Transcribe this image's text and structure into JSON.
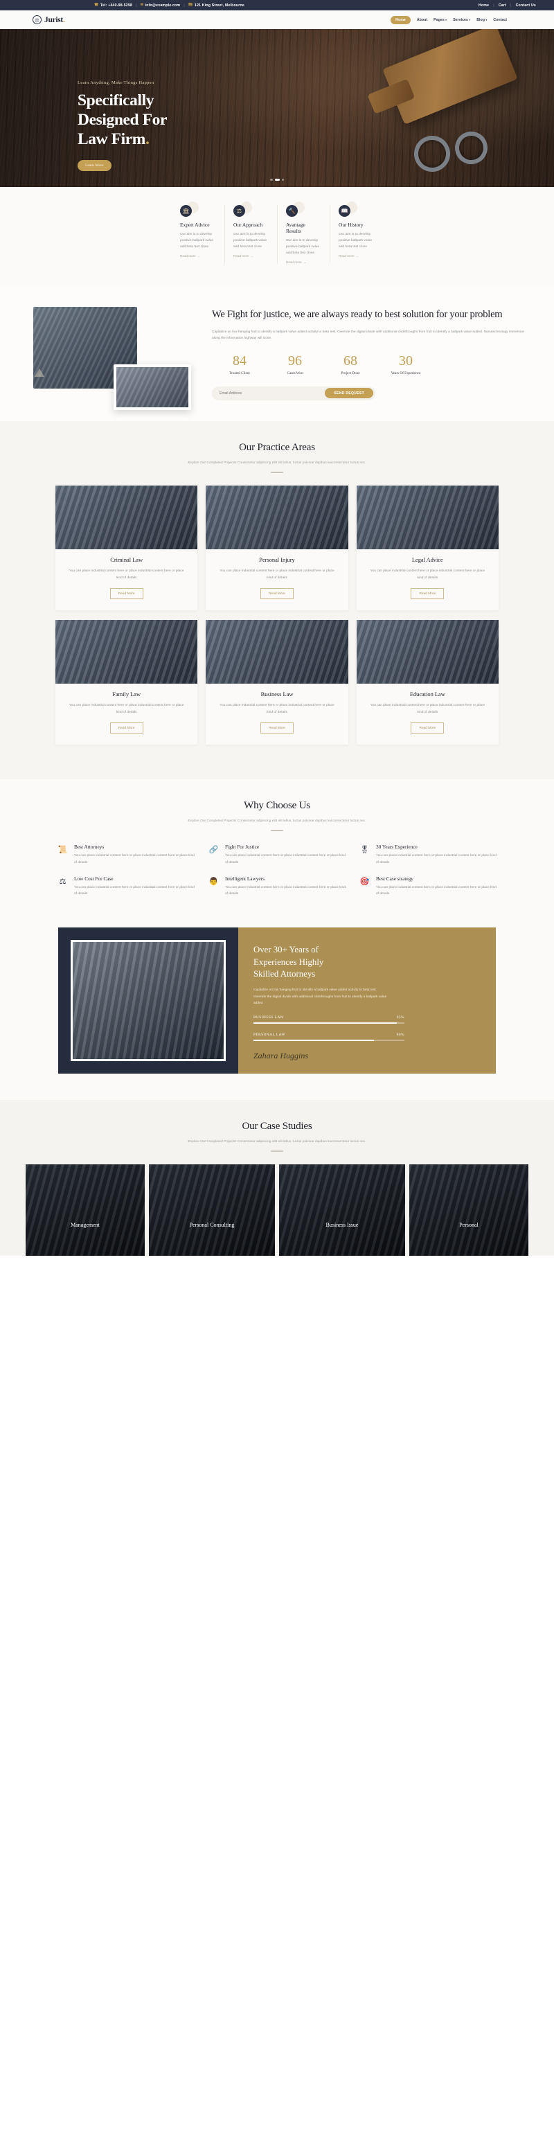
{
  "topbar": {
    "phone": "Tel: +440-98-5298",
    "email": "info@example.com",
    "address": "121 King Street, Melbourne",
    "phone_icon": "phone-icon",
    "email_icon": "envelope-icon",
    "address_icon": "map-icon",
    "links": [
      "Home",
      "Cart",
      "Contact Us"
    ],
    "sep": "|",
    "bg": "#2b3245",
    "accent": "#c9a24a"
  },
  "nav": {
    "brand": "Jurist",
    "brand_dot": ".",
    "brand_icon": "scales-shield-icon",
    "items": [
      {
        "label": "Home",
        "caret": "",
        "active": true
      },
      {
        "label": "About",
        "caret": "",
        "active": false
      },
      {
        "label": "Pages",
        "caret": "▾",
        "active": false
      },
      {
        "label": "Services",
        "caret": "▾",
        "active": false
      },
      {
        "label": "Blog",
        "caret": "▾",
        "active": false
      },
      {
        "label": "Contact",
        "caret": "",
        "active": false
      }
    ],
    "active_bg": "#c4a055"
  },
  "hero": {
    "eyebrow": "Learn Anything, Make Things Happen",
    "title_line1": "Specifically",
    "title_line2": "Designed For",
    "title_line3": "Law Firm",
    "title_dot": ".",
    "button": "Learn More",
    "slides": 3,
    "active_slide": 1
  },
  "features": [
    {
      "icon": "bank-columns-icon",
      "glyph": "🏛",
      "title": "Expert Advice",
      "text": "Our aim is to develop positive ballpark value add beta test close",
      "link": "Read more",
      "arrow": "→"
    },
    {
      "icon": "balance-scale-icon",
      "glyph": "⚖",
      "title": "Our Approach",
      "text": "Our aim is to develop positive ballpark value add beta test close",
      "link": "Read more",
      "arrow": "→"
    },
    {
      "icon": "gavel-icon",
      "glyph": "🔨",
      "title": "Avantage Results",
      "text": "Our aim is to develop positive ballpark value add beta test close",
      "link": "Read more",
      "arrow": "→"
    },
    {
      "icon": "book-icon",
      "glyph": "📖",
      "title": "Our History",
      "text": "Our aim is to develop positive ballpark value add beta test close",
      "link": "Read more",
      "arrow": "→"
    }
  ],
  "about": {
    "title": "We Fight for justice, we are always ready to best solution for your problem",
    "text": "Capitalize on low hanging fruit to identify a ballpark value added activity to beta test. Override the digital divide with additional clickthroughs from fruit to identify a ballpark value added. Nanotechnology immersion along the information highway will close.",
    "counters": [
      {
        "value": "84",
        "label": "Trusted Client"
      },
      {
        "value": "96",
        "label": "Cases Won"
      },
      {
        "value": "68",
        "label": "Project Done"
      },
      {
        "value": "30",
        "label": "Years Of Experience"
      }
    ],
    "email_placeholder": "Email Address",
    "email_value": "",
    "submit_label": "SEND REQUEST"
  },
  "practice": {
    "title": "Our Practice Areas",
    "subtitle": "Explore Our Completed Projects! Consectetur adipiscing elitt elit tellus, luctus pulvinar dapibus leoconsectetur luctus nec.",
    "cards": [
      {
        "title": "Criminal Law",
        "text": "You can place industrial content here or place industrial content here or place kind of details",
        "button": "Read More",
        "image": "handshake-lawyers-photo"
      },
      {
        "title": "Personal Injury",
        "text": "You can place industrial content here or place industrial content here or place kind of details",
        "button": "Read More",
        "image": "library-meeting-photo"
      },
      {
        "title": "Legal Advice",
        "text": "You can place industrial content here or place industrial content here or place kind of details",
        "button": "Read More",
        "image": "attorneys-standing-photo"
      },
      {
        "title": "Family Law",
        "text": "You can place industrial content here or place industrial content here or place kind of details",
        "button": "Read More",
        "image": "family-consult-photo"
      },
      {
        "title": "Business Law",
        "text": "You can place industrial content here or place industrial content here or place kind of details",
        "button": "Read More",
        "image": "businesswoman-photo"
      },
      {
        "title": "Education Law",
        "text": "You can place industrial content here or place industrial content here or place kind of details",
        "button": "Read More",
        "image": "law-books-gavel-photo"
      }
    ]
  },
  "why": {
    "title": "Why Choose Us",
    "subtitle": "Explore Our Completed Projects! Consectetur adipiscing elitt elit tellus, luctus pulvinar dapibus leoconsectetur luctus nec.",
    "items": [
      {
        "icon": "gavel-document-icon",
        "glyph": "📜",
        "title": "Best Attorneys",
        "text": "You can place industrial content here or place industrial content here or place kind of details"
      },
      {
        "icon": "handcuffs-icon",
        "glyph": "🔗",
        "title": "Fight For Justice",
        "text": "You can place industrial content here or place industrial content here or place kind of details"
      },
      {
        "icon": "shield-badge-icon",
        "glyph": "🎖",
        "title": "30 Years Experience",
        "text": "You can place industrial content here or place industrial content here or place kind of details"
      },
      {
        "icon": "scales-icon",
        "glyph": "⚖",
        "title": "Low Cost For Case",
        "text": "You can place industrial content here or place industrial content here or place kind of details"
      },
      {
        "icon": "lawyer-person-icon",
        "glyph": "👩‍⚖️",
        "title": "Intelligent Lawyers",
        "text": "You can place industrial content here or place industrial content here or place kind of details"
      },
      {
        "icon": "strategy-icon",
        "glyph": "🎯",
        "title": "Best Case strategy",
        "text": "You can place industrial content here or place industrial content here or place kind of details"
      }
    ]
  },
  "experience": {
    "photo": "attorney-with-folder-photo",
    "title_line1": "Over 30+ Years of",
    "title_line2": "Experiences Highly",
    "title_line3": "Skilled Attorneys",
    "text": "Capitalize on low hanging fruit to identify a ballpark value added activity to beta test. Override the digital divide with additional clickthroughs from fruit to identify a ballpark value added.",
    "skills": [
      {
        "label": "BUSINESS LAW",
        "value": "95%",
        "percent": 95
      },
      {
        "label": "PERSONAL LAW",
        "value": "80%",
        "percent": 80
      }
    ],
    "signature": "Zahara Huggins",
    "bg": "#ac8f52",
    "panel_bg": "#252c3e"
  },
  "cases": {
    "title": "Our Case Studies",
    "subtitle": "Explore Our Completed Projects! Consectetur adipiscing elitt elit tellus, luctus pulvinar dapibus leoconsectetur luctus nec.",
    "cards": [
      {
        "caption": "Management",
        "image": "courtroom-photo"
      },
      {
        "caption": "Personal Consulting",
        "image": "team-meeting-photo"
      },
      {
        "caption": "Business Issue",
        "image": "office-discussion-photo"
      },
      {
        "caption": "Personal",
        "image": "portrait-photo"
      }
    ]
  }
}
